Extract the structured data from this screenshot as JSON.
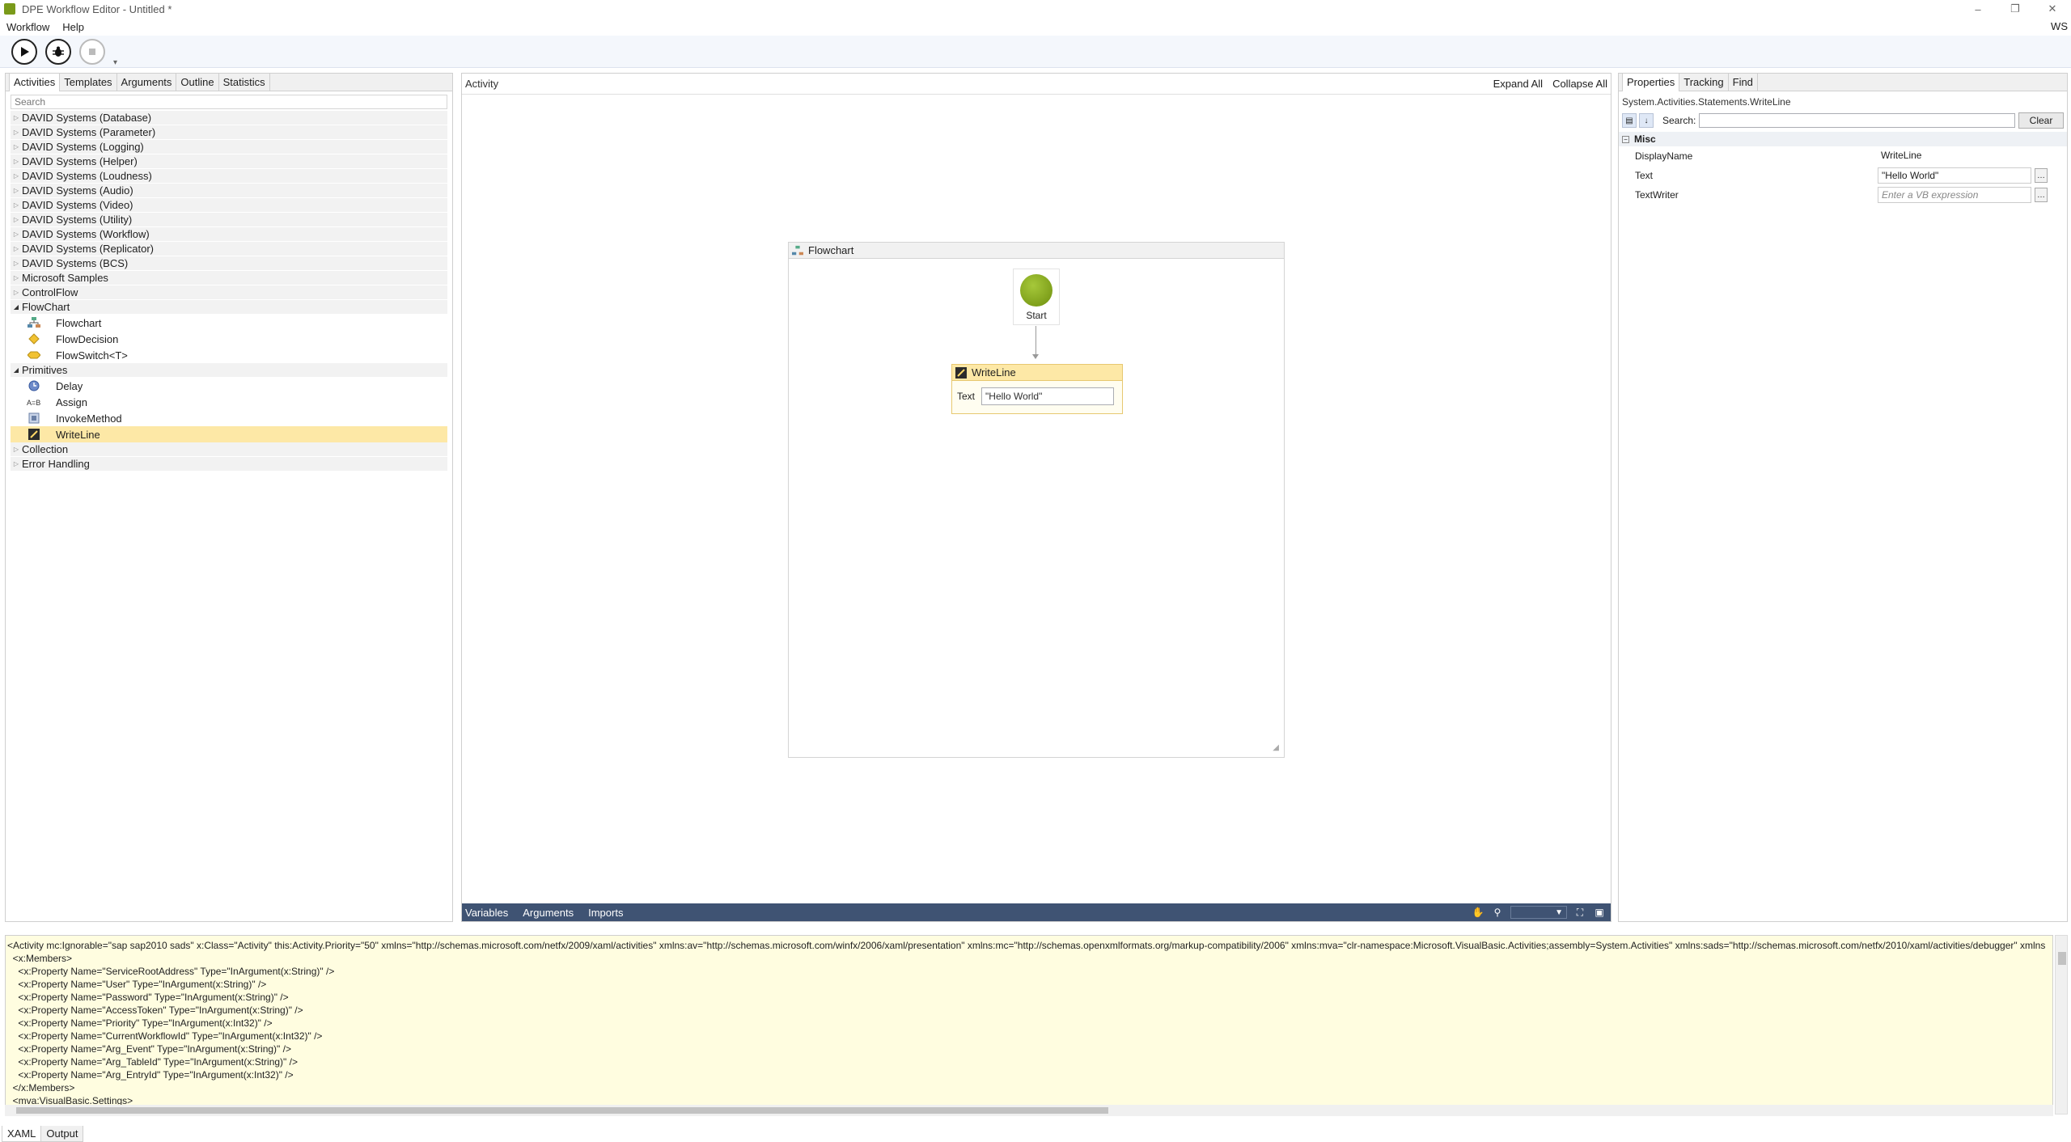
{
  "window": {
    "title": "DPE Workflow Editor - Untitled *",
    "controls": [
      "–",
      "❐",
      "✕"
    ]
  },
  "menu": {
    "items": [
      "Workflow",
      "Help"
    ],
    "user": "WS"
  },
  "toolbox": {
    "tabs": [
      "Activities",
      "Templates",
      "Arguments",
      "Outline",
      "Statistics"
    ],
    "search_placeholder": "Search",
    "categories": [
      {
        "label": "DAVID Systems (Database)"
      },
      {
        "label": "DAVID Systems (Parameter)"
      },
      {
        "label": "DAVID Systems (Logging)"
      },
      {
        "label": "DAVID Systems (Helper)"
      },
      {
        "label": "DAVID Systems (Loudness)"
      },
      {
        "label": "DAVID Systems (Audio)"
      },
      {
        "label": "DAVID Systems (Video)"
      },
      {
        "label": "DAVID Systems (Utility)"
      },
      {
        "label": "DAVID Systems (Workflow)"
      },
      {
        "label": "DAVID Systems (Replicator)"
      },
      {
        "label": "DAVID Systems (BCS)"
      },
      {
        "label": "Microsoft Samples"
      },
      {
        "label": "ControlFlow"
      },
      {
        "label": "FlowChart"
      },
      {
        "label": "Primitives"
      },
      {
        "label": "Collection"
      },
      {
        "label": "Error Handling"
      }
    ],
    "flowchart_items": [
      {
        "label": "Flowchart"
      },
      {
        "label": "FlowDecision"
      },
      {
        "label": "FlowSwitch<T>"
      }
    ],
    "primitive_items": [
      {
        "label": "Delay"
      },
      {
        "label": "Assign"
      },
      {
        "label": "InvokeMethod"
      },
      {
        "label": "WriteLine"
      }
    ]
  },
  "designer": {
    "title": "Activity",
    "expand_all": "Expand All",
    "collapse_all": "Collapse All",
    "flowchart_title": "Flowchart",
    "start_label": "Start",
    "writeline": {
      "title": "WriteLine",
      "text_label": "Text",
      "text_value": "\"Hello World\""
    },
    "bottom_tabs": [
      "Variables",
      "Arguments",
      "Imports"
    ]
  },
  "properties": {
    "tabs": [
      "Properties",
      "Tracking",
      "Find"
    ],
    "type_name": "System.Activities.Statements.WriteLine",
    "search_label": "Search:",
    "clear_label": "Clear",
    "category": "Misc",
    "rows": [
      {
        "name": "DisplayName",
        "value": "WriteLine"
      },
      {
        "name": "Text",
        "value": "\"Hello World\""
      },
      {
        "name": "TextWriter",
        "value": "Enter a VB expression"
      }
    ]
  },
  "xaml": {
    "lines": [
      "<Activity mc:Ignorable=\"sap sap2010 sads\" x:Class=\"Activity\" this:Activity.Priority=\"50\" xmlns=\"http://schemas.microsoft.com/netfx/2009/xaml/activities\" xmlns:av=\"http://schemas.microsoft.com/winfx/2006/xaml/presentation\" xmlns:mc=\"http://schemas.openxmlformats.org/markup-compatibility/2006\" xmlns:mva=\"clr-namespace:Microsoft.VisualBasic.Activities;assembly=System.Activities\" xmlns:sads=\"http://schemas.microsoft.com/netfx/2010/xaml/activities/debugger\" xmlns",
      "  <x:Members>",
      "    <x:Property Name=\"ServiceRootAddress\" Type=\"InArgument(x:String)\" />",
      "    <x:Property Name=\"User\" Type=\"InArgument(x:String)\" />",
      "    <x:Property Name=\"Password\" Type=\"InArgument(x:String)\" />",
      "    <x:Property Name=\"AccessToken\" Type=\"InArgument(x:String)\" />",
      "    <x:Property Name=\"Priority\" Type=\"InArgument(x:Int32)\" />",
      "    <x:Property Name=\"CurrentWorkflowId\" Type=\"InArgument(x:Int32)\" />",
      "    <x:Property Name=\"Arg_Event\" Type=\"InArgument(x:String)\" />",
      "    <x:Property Name=\"Arg_TableId\" Type=\"InArgument(x:String)\" />",
      "    <x:Property Name=\"Arg_EntryId\" Type=\"InArgument(x:Int32)\" />",
      "  </x:Members>",
      "  <mva:VisualBasic.Settings>"
    ]
  },
  "bottom_tabs": [
    "XAML",
    "Output"
  ]
}
